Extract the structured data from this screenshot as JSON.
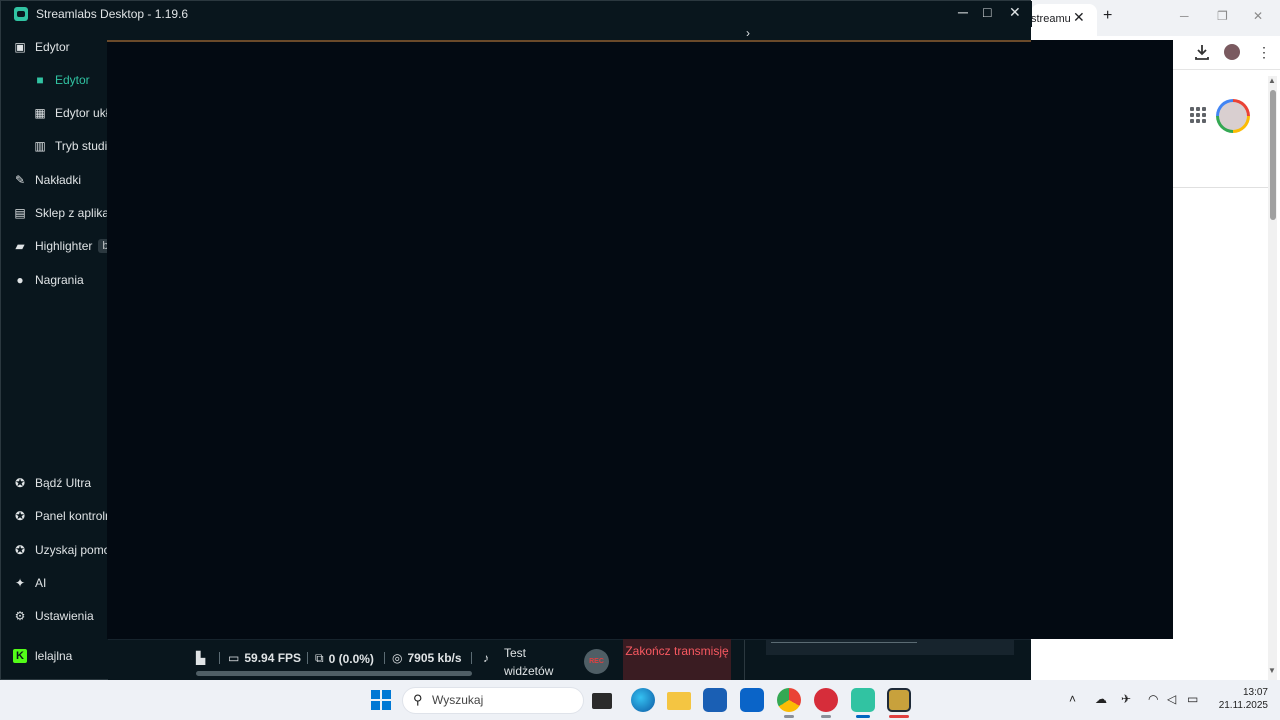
{
  "window": {
    "title": "Streamlabs Desktop - 1.19.6",
    "minimize": "─",
    "maximize": "□",
    "close": "✕"
  },
  "sidebar": {
    "items": [
      {
        "label": "Edytor",
        "icon": "editor-icon"
      },
      {
        "label": "Edytor",
        "icon": "camera-icon",
        "active": true
      },
      {
        "label": "Edytor układu",
        "icon": "layout-grid-icon"
      },
      {
        "label": "Tryb studia",
        "icon": "studio-mode-icon"
      },
      {
        "label": "Nakładki",
        "icon": "overlays-icon"
      },
      {
        "label": "Sklep z aplikacjami",
        "icon": "store-icon"
      },
      {
        "label": "Highlighter",
        "icon": "highlighter-icon",
        "badge": "b"
      },
      {
        "label": "Nagrania",
        "icon": "recordings-icon"
      }
    ],
    "bottom_items": [
      {
        "label": "Bądź Ultra",
        "icon": "ultra-icon"
      },
      {
        "label": "Panel kontrolny",
        "icon": "dashboard-icon"
      },
      {
        "label": "Uzyskaj pomoc",
        "icon": "help-icon"
      },
      {
        "label": "AI",
        "icon": "sparkle-icon"
      },
      {
        "label": "Ustawienia",
        "icon": "gear-icon"
      }
    ],
    "user": {
      "name": "lelajlna",
      "icon": "kick-logo-icon"
    },
    "collapse_icon": "→|"
  },
  "footer": {
    "fps": "59.94 FPS",
    "dropped": "0 (0.0%)",
    "bitrate": "7905 kb/s",
    "test_widgets": "Test widżetów",
    "rec": "REC",
    "end_stream": "Zakończ transmisję"
  },
  "browser": {
    "tab_title": "streamu",
    "tab_close": "✕",
    "new_tab": "+",
    "minimize": "─",
    "maximize": "❐",
    "close": "✕",
    "menu": "⋮"
  },
  "taskbar": {
    "search_placeholder": "Wyszukaj",
    "time": "13:07",
    "date": "21.11.2025"
  }
}
